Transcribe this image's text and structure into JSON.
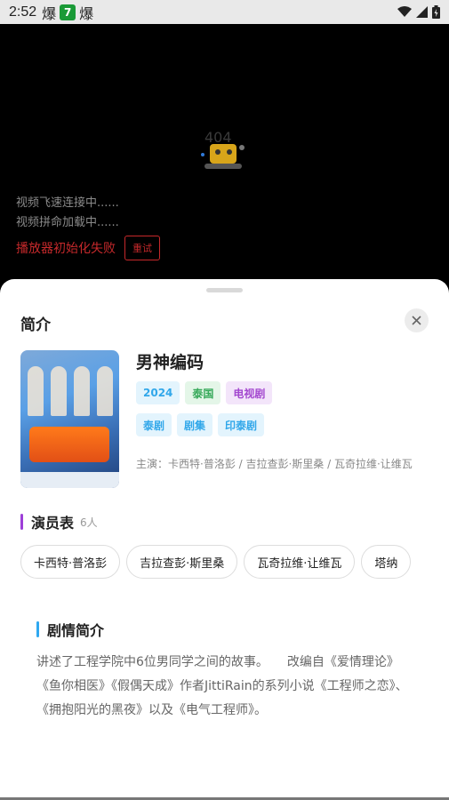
{
  "status_bar": {
    "time": "2:52",
    "icon1": "爆",
    "icon2": "7",
    "icon3": "爆"
  },
  "player": {
    "error_image": "404-robot-image",
    "loading_lines": [
      "视频飞速连接中......",
      "视频拼命加载中......"
    ],
    "error_text": "播放器初始化失败",
    "retry_label": "重试"
  },
  "sheet": {
    "title": "简介",
    "show": {
      "name": "男神编码",
      "tags_row1": [
        {
          "label": "2024",
          "color": "blue"
        },
        {
          "label": "泰国",
          "color": "green"
        },
        {
          "label": "电视剧",
          "color": "purple"
        }
      ],
      "tags_row2": [
        {
          "label": "泰剧",
          "color": "blue"
        },
        {
          "label": "剧集",
          "color": "blue"
        },
        {
          "label": "印泰剧",
          "color": "blue"
        }
      ],
      "starring": "主演：卡西特·普洛彭 / 吉拉查彭·斯里桑 / 瓦奇拉维·让维瓦"
    },
    "cast": {
      "title": "演员表",
      "count": "6人",
      "members": [
        "卡西特·普洛彭",
        "吉拉查彭·斯里桑",
        "瓦奇拉维·让维瓦",
        "塔纳"
      ]
    },
    "plot": {
      "title": "剧情简介",
      "text": "讲述了工程学院中6位男同学之间的故事。　　改编自《爱情理论》《鱼你相医》《假偶天成》作者JittiRain的系列小说《工程师之恋》、《拥抱阳光的黑夜》以及《电气工程师》。"
    }
  },
  "colors": {
    "accent_purple": "#9d3fd8",
    "accent_blue": "#2fa8f0",
    "error_red": "#c6292b"
  }
}
